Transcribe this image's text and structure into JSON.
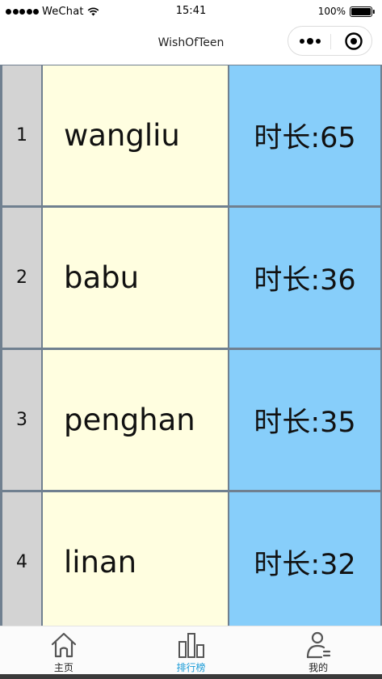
{
  "status_bar": {
    "carrier": "WeChat",
    "time": "15:41",
    "battery": "100%"
  },
  "nav": {
    "title": "WishOfTeen"
  },
  "rank_list": {
    "duration_prefix": "时长:",
    "rows": [
      {
        "rank": "1",
        "name": "wangliu",
        "duration": "时长:65"
      },
      {
        "rank": "2",
        "name": "babu",
        "duration": "时长:36"
      },
      {
        "rank": "3",
        "name": "penghan",
        "duration": "时长:35"
      },
      {
        "rank": "4",
        "name": "linan",
        "duration": "时长:32"
      }
    ]
  },
  "colors": {
    "rank_cell": "#d3d3d3",
    "name_cell": "#fffee0",
    "duration_cell": "#87cefa",
    "border": "#708090",
    "tab_active": "#1a9bd7"
  },
  "tab_bar": {
    "items": [
      {
        "label": "主页",
        "icon": "home-icon",
        "active": false
      },
      {
        "label": "排行榜",
        "icon": "bar-chart-icon",
        "active": true
      },
      {
        "label": "我的",
        "icon": "user-icon",
        "active": false
      }
    ]
  }
}
